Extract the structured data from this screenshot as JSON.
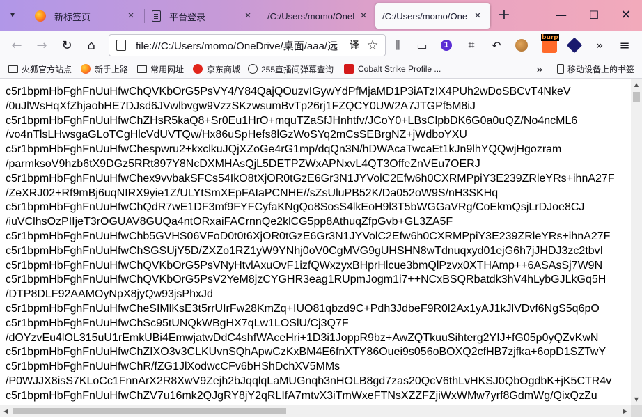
{
  "tabs": [
    {
      "title": "新标签页",
      "favicon": "firefox-icon"
    },
    {
      "title": "平台登录",
      "favicon": "page-icon"
    },
    {
      "title": "/C:/Users/momo/OneD",
      "favicon": "none"
    },
    {
      "title": "/C:/Users/momo/OneD",
      "favicon": "none",
      "active": true
    }
  ],
  "navbar": {
    "url": "file:///C:/Users/momo/OneDrive/桌面/aaa/远",
    "translate_label": "译",
    "extension_badge": "1",
    "burp_label": "burp"
  },
  "bookmarks": [
    {
      "label": "火狐官方站点",
      "icon": "folder-icon"
    },
    {
      "label": "新手上路",
      "icon": "firefox-icon"
    },
    {
      "label": "常用网址",
      "icon": "folder-icon"
    },
    {
      "label": "京东商城",
      "icon": "jd-icon"
    },
    {
      "label": "255直播间弹幕查询",
      "icon": "globe-icon"
    },
    {
      "label": "Cobalt Strike Profile ...",
      "icon": "cobalt-strike-icon"
    },
    {
      "label": "移动设备上的书签",
      "icon": "mobile-icon"
    }
  ],
  "content_lines": [
    "c5r1bpmHbFghFnUuHfwChQVKbOrG5PsVY4/Y84QajQOuzvIGywYdPfMjaMD1P3iATzIX4PUh2wDoSBCvT4NkeV",
    "/0uJlWsHqXfZhjaobHE7DJsd6JVwlbvgw9VzzSKzwsumBvTp26rj1FZQCY0UW2A7JTGPf5M8iJ",
    "c5r1bpmHbFghFnUuHfwChZHsR5kaQ8+Sr0Eu1HrO+mquTZaSfJHnhtfv/JCoY0+LBsClpbDK6G0a0uQZ/No4ncML6",
    "/vo4nTlsLHwsgaGLoTCgHlcVdUVTQw/Hx86uSpHefs8lGzWoSYq2mCsSEBrgNZ+jWdboYXU",
    "c5r1bpmHbFghFnUuHfwChespwru2+kxclkuJQjXZoGe4rG1mp/dqQn3N/hDWAcaTwcaEt1kJn9lhYQQwjHgozram",
    "/parmksoV9hzb6tX9DGz5RRt897Y8NcDXMHAsQjL5DETPZWxAPNxvL4QT3OffeZnVEu7OERJ",
    "c5r1bpmHbFghFnUuHfwChex9vvbakSFCs54IkO8tXjOR0tGzE6Gr3N1JYVolC2Efw6h0CXRMPpiY3E239ZRleYRs+ihnA27F",
    "/ZeXRJ02+Rf9mBj6uqNIRX9yie1Z/ULYtSmXEpFAIaPCNHE//sZsUluPB52K/Da052oW9S/nH3SKHq",
    "c5r1bpmHbFghFnUuHfwChQdR7wE1DF3mf9FYFCyfaKNgQo8SosS4lkEoH9l3T5bWGGaVRg/CoEkmQsjLrDJoe8CJ",
    "/iuVClhsOzPIIjeT3rOGUAV8GUQa4ntORxaiFACrnnQe2klCG5pp8AthuqZfpGvb+GL3ZA5F",
    "c5r1bpmHbFghFnUuHfwChb5GVHS06VFoD0t0t6XjOR0tGzE6Gr3N1JYVolC2Efw6h0CXRMPpiY3E239ZRleYRs+ihnA27F",
    "c5r1bpmHbFghFnUuHfwChSGSUjY5D/ZXZo1RZ1yW9YNhj0oV0CgMVG9gUHSHN8wTdnuqxyd01ejG6h7jJHDJ3zc2tbvI",
    "c5r1bpmHbFghFnUuHfwChQVKbOrG5PsVNyHtvlAxuOvF1izfQWxzyxBHprHlcue3bmQlPzvx0XTHAmp++6ASAsSj7W9N",
    "c5r1bpmHbFghFnUuHfwChQVKbOrG5PsV2YeM8jzCYGHR3eag1RUpmJogm1i7++NCxBSQRbatdk3hV4hLybGJLkGq5H",
    "/DTP8DLF92AAMOyNpX8jyQw93jsPhxJd",
    "c5r1bpmHbFghFnUuHfwCheSIMlKsE3t5rrUIrFw28KmZq+IUO81qbzd9C+Pdh3JdbeF9R0l2Ax1yAJ1kJlVDvf6NgS5q6pO",
    "c5r1bpmHbFghFnUuHfwChSc95tUNQkWBgHX7qLw1LOSlU/Cj3Q7F",
    "/dOYzvEu4lOL315uU1rEmkUBi4EmwjatwDdC4shfWAceHri+1D3i1JoppR9bz+AwZQTkuuSihterg2YIJ+fG05p0yQZvKwN",
    "c5r1bpmHbFghFnUuHfwChZIXO3v3CLKUvnSQhApwCzKxBM4E6fnXTY86Ouei9s056oBOXQ2cfHB7zjfka+6opD1SZTwY",
    "c5r1bpmHbFghFnUuHfwChR/fZG1JlXodwcCFv6bHShDchXV5MMs",
    "/P0WJJX8isS7KLoCc1FnnArX2R8XwV9Zejh2bJqqlqLaMUGnqb3nHOLB8gd7zas20QcV6thLvHKSJ0QbOgdbK+jK5CTR4v",
    "c5r1bpmHbFghFnUuHfwChZV7u16mk2QJgRY8jY2qRLIfA7mtvX3iTmWxeFTNsXZZFZjiWxWMw7yrf8GdmWg/QixQzZu"
  ]
}
